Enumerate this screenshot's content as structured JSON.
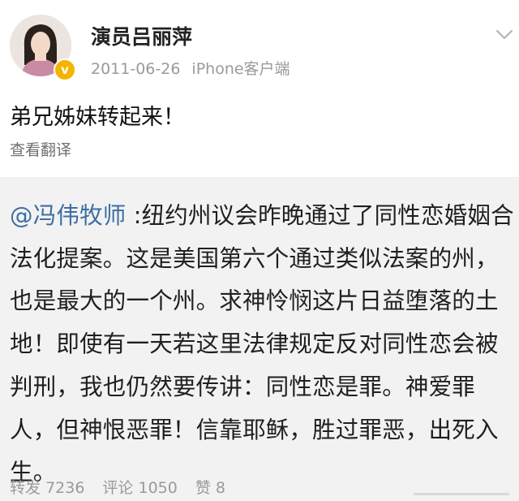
{
  "post": {
    "username": "演员吕丽萍",
    "date": "2011-06-26",
    "source": "iPhone客户端",
    "text": "弟兄姊妹转起来！",
    "translate_label": "查看翻译"
  },
  "quoted": {
    "mention": "@冯伟牧师",
    "body": " :纽约州议会昨晚通过了同性恋婚姻合法化提案。这是美国第六个通过类似法案的州，也是最大的一个州。求神怜悯这片日益堕落的土地！即使有一天若这里法律规定反对同性恋会被判刑，我也仍然要传讲：同性恋是罪。神爱罪人，但神恨恶罪！信靠耶稣，胜过罪恶，出死入生。",
    "repost_label": "转发",
    "repost_count": "7236",
    "comment_label": "评论",
    "comment_count": "1050",
    "like_label": "赞",
    "like_count": "8"
  },
  "colors": {
    "mention": "#3e6ea3",
    "meta_gray": "#9a9a9a",
    "quote_bg": "#f2f2f2",
    "verified_badge": "#f5b400"
  },
  "icons": {
    "verified": "verified-badge-icon",
    "chevron": "chevron-down-icon"
  }
}
